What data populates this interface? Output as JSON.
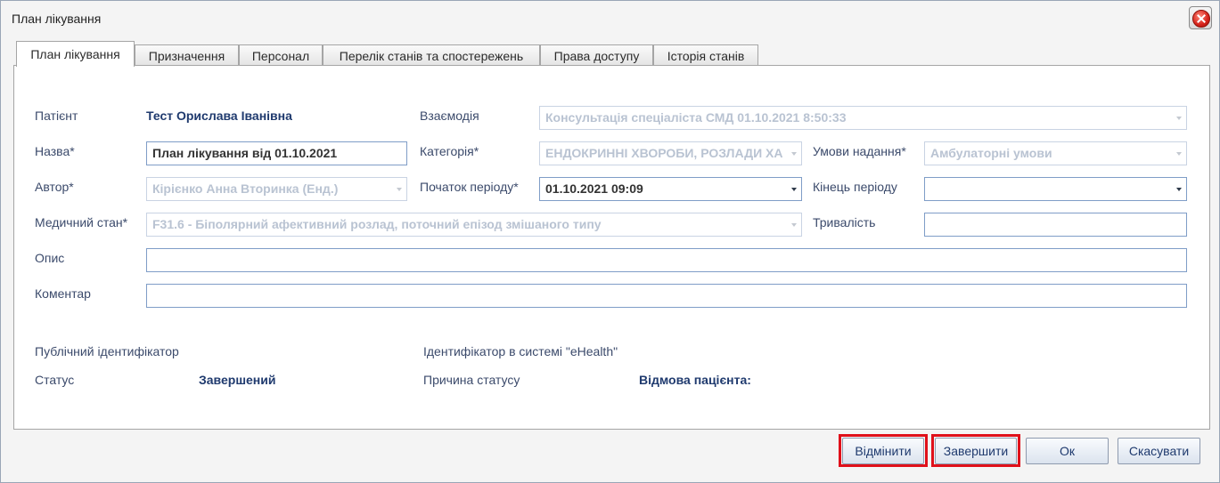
{
  "window": {
    "title": "План лікування"
  },
  "tabs": [
    {
      "label": "План лікування"
    },
    {
      "label": "Призначення"
    },
    {
      "label": "Персонал"
    },
    {
      "label": "Перелік станів та спостережень"
    },
    {
      "label": "Права доступу"
    },
    {
      "label": "Історія станів"
    }
  ],
  "form": {
    "patient": {
      "label": "Патієнт",
      "value": "Тест Орислава Іванівна"
    },
    "interaction": {
      "label": "Взаємодія",
      "value": "Консультація спеціаліста СМД 01.10.2021 8:50:33"
    },
    "name": {
      "label": "Назва*",
      "value": "План лікування від 01.10.2021"
    },
    "category": {
      "label": "Категорія*",
      "value": "ЕНДОКРИННІ ХВОРОБИ, РОЗЛАДИ ХА"
    },
    "conditions": {
      "label": "Умови надання*",
      "value": "Амбулаторні умови"
    },
    "author": {
      "label": "Автор*",
      "value": "Кірієнко Анна Вторинка (Енд.)"
    },
    "period_start": {
      "label": "Початок періоду*",
      "value": "01.10.2021 09:09"
    },
    "period_end": {
      "label": "Кінець періоду",
      "value": ""
    },
    "medical_state": {
      "label": "Медичний стан*",
      "value": "F31.6 - Біполярний афективний розлад, поточний епізод змішаного типу"
    },
    "duration": {
      "label": "Тривалість",
      "value": ""
    },
    "description": {
      "label": "Опис",
      "value": ""
    },
    "comment": {
      "label": "Коментар",
      "value": ""
    }
  },
  "info": {
    "public_id_label": "Публічний ідентифікатор",
    "ehealth_id_label": "Ідентифікатор в системі \"eHealth\"",
    "status_label": "Статус",
    "status_value": "Завершений",
    "status_reason_label": "Причина статусу",
    "status_reason_value": "Відмова пацієнта:"
  },
  "buttons": {
    "cancel_plan": "Відмінити",
    "finish": "Завершити",
    "ok": "Ок",
    "close": "Скасувати"
  },
  "colors": {
    "highlight": "#e0101a",
    "label": "#3b4a6b",
    "value": "#1f3a6e"
  }
}
